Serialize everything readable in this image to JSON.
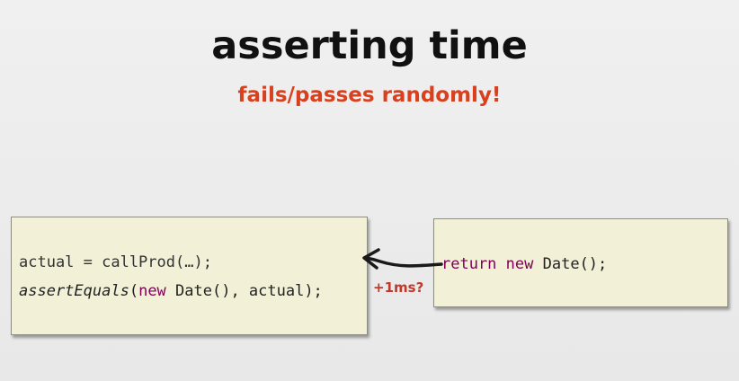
{
  "slide": {
    "title": "asserting time",
    "subtitle": "fails/passes randomly!"
  },
  "test_code": {
    "line1": "actual = callProd(…);",
    "line2_call": "assertEquals",
    "line2_open": "(",
    "line2_keyword": "new",
    "line2_rest": " Date(), actual);"
  },
  "prod_code": {
    "keyword_return": "return",
    "keyword_new": "new",
    "rest": " Date();"
  },
  "annotation": "+1ms?",
  "colors": {
    "keyword": "#7f0055",
    "subtitle": "#d8401e",
    "box_background": "#f2f0d6"
  }
}
